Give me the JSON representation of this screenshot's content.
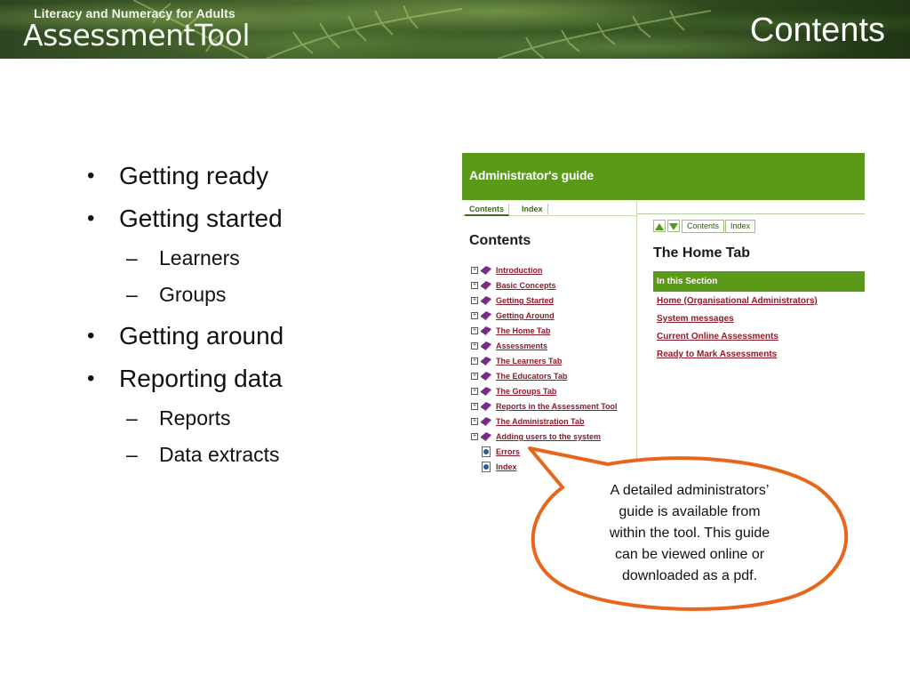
{
  "header": {
    "brand_small": "Literacy and Numeracy for Adults",
    "brand_large": "AssessmentTool",
    "slide_title": "Contents"
  },
  "bullets": [
    {
      "text": "Getting ready",
      "level": 1
    },
    {
      "text": "Getting started",
      "level": 1
    },
    {
      "text": "Learners",
      "level": 2
    },
    {
      "text": "Groups",
      "level": 2
    },
    {
      "text": "Getting around",
      "level": 1
    },
    {
      "text": "Reporting data",
      "level": 1
    },
    {
      "text": "Reports",
      "level": 2
    },
    {
      "text": "Data extracts",
      "level": 2
    }
  ],
  "guide": {
    "header_title": "Administrator's guide",
    "tabs": [
      "Contents",
      "Index"
    ],
    "contents_heading": "Contents",
    "toc": [
      "Introduction",
      "Basic Concepts",
      "Getting Started",
      "Getting Around",
      "The Home Tab",
      "Assessments",
      "The Learners Tab",
      "The Educators Tab",
      "The Groups Tab",
      "Reports in the Assessment Tool",
      "The Administration Tab",
      "Adding users to the system"
    ],
    "toc_pages": [
      "Errors",
      "Index"
    ],
    "nav_buttons": [
      "Contents",
      "Index"
    ],
    "page_title": "The Home Tab",
    "section_label": "In this Section",
    "section_links": [
      "Home (Organisational Administrators)",
      "System messages",
      "Current Online Assessments",
      "Ready to Mark Assessments"
    ]
  },
  "callout": {
    "lines": [
      "A detailed administrators’",
      "guide is available from",
      "within the tool.  This guide",
      "can be viewed online or",
      "downloaded as a pdf."
    ]
  },
  "colors": {
    "guide_green": "#5a9a18",
    "link_maroon": "#8f1a2a",
    "callout_border": "#e8661c"
  }
}
